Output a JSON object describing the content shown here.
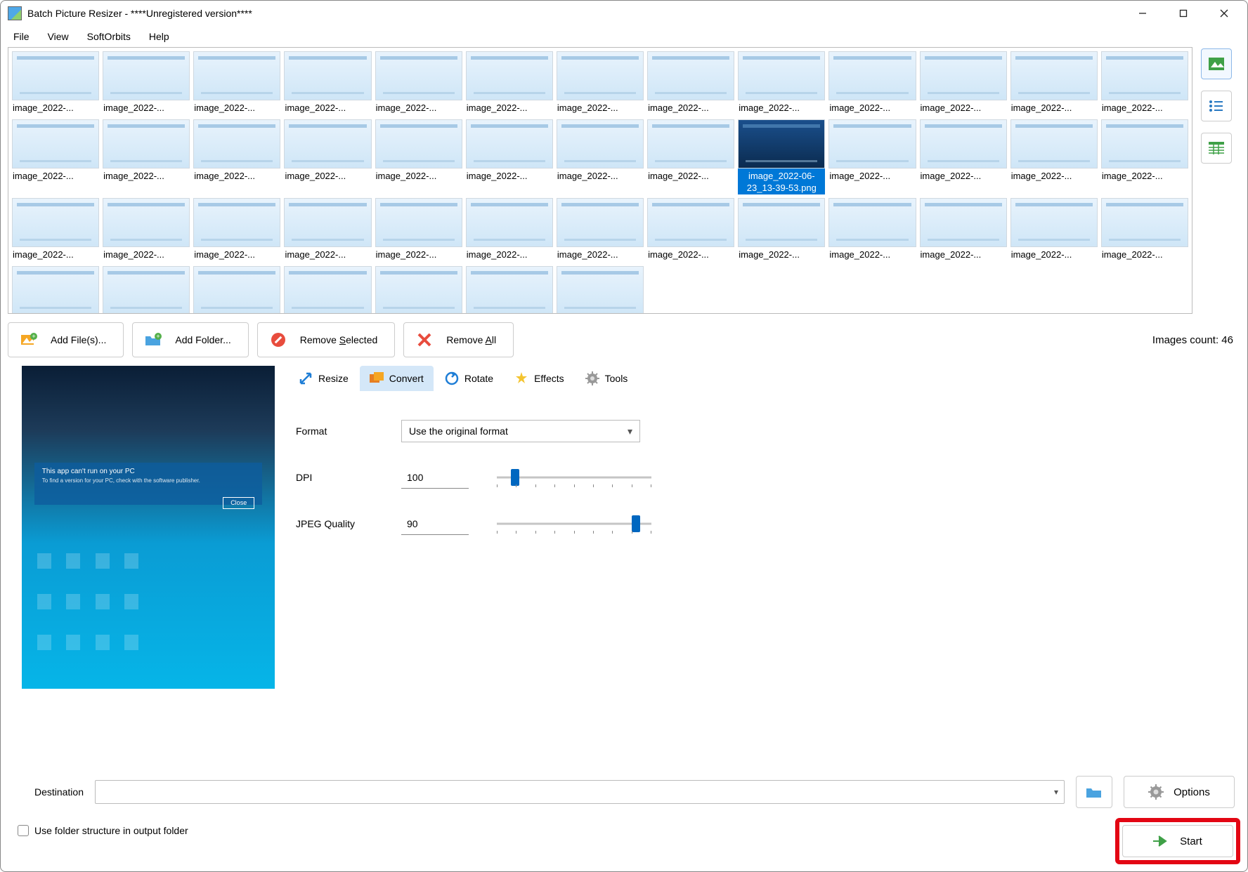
{
  "window": {
    "title": "Batch Picture Resizer - ****Unregistered version****"
  },
  "menu": {
    "items": [
      "File",
      "View",
      "SoftOrbits",
      "Help"
    ]
  },
  "thumbnails": {
    "generic_label": "image_2022-...",
    "selected_label": "image_2022-06-23_13-39-53.png",
    "selected_index": 21,
    "count": 46
  },
  "toolbar": {
    "add_files": "Add File(s)...",
    "add_folder": "Add Folder...",
    "remove_selected_prefix": "Remove ",
    "remove_selected_key": "S",
    "remove_selected_suffix": "elected",
    "remove_all_prefix": "Remove ",
    "remove_all_key": "A",
    "remove_all_suffix": "ll",
    "count_label": "Images count: 46"
  },
  "tabs": {
    "items": [
      "Resize",
      "Convert",
      "Rotate",
      "Effects",
      "Tools"
    ],
    "active": 1
  },
  "convert": {
    "format_label": "Format",
    "format_value": "Use the original format",
    "dpi_label": "DPI",
    "dpi_value": "100",
    "quality_label": "JPEG Quality",
    "quality_value": "90"
  },
  "destination": {
    "label": "Destination",
    "value": "",
    "checkbox": "Use folder structure in output folder"
  },
  "buttons": {
    "options": "Options",
    "start": "Start"
  },
  "preview": {
    "dialog_title": "This app can't run on your PC",
    "dialog_body": "To find a version for your PC, check with the software publisher.",
    "dialog_btn": "Close"
  }
}
